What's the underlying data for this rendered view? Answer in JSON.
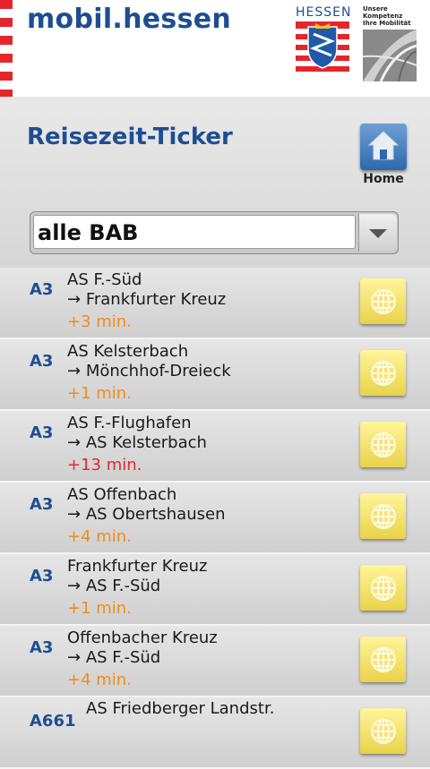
{
  "header": {
    "app_title": "mobil.hessen",
    "hessen_logo_text": "HESSEN",
    "mobility_slogan": "Unsere Kompetenz Ihre Mobilität",
    "stripe_colors": [
      "#e4262b",
      "#ffffff"
    ]
  },
  "page": {
    "title": "Reisezeit-Ticker",
    "home_label": "Home"
  },
  "filter": {
    "selected": "alle BAB"
  },
  "colors": {
    "brand_blue": "#1e4e91",
    "delay_orange": "#f08c1e",
    "delay_red": "#e22828"
  },
  "routes": [
    {
      "road": "A3",
      "from": "AS F.-Süd",
      "to": "Frankfurter Kreuz",
      "delay": "+3 min.",
      "level": "orange"
    },
    {
      "road": "A3",
      "from": "AS Kelsterbach",
      "to": "Mönchhof-Dreieck",
      "delay": "+1 min.",
      "level": "orange"
    },
    {
      "road": "A3",
      "from": "AS F.-Flughafen",
      "to": "AS Kelsterbach",
      "delay": "+13 min.",
      "level": "red"
    },
    {
      "road": "A3",
      "from": "AS Offenbach",
      "to": "AS Obertshausen",
      "delay": "+4 min.",
      "level": "orange"
    },
    {
      "road": "A3",
      "from": "Frankfurter Kreuz",
      "to": "AS F.-Süd",
      "delay": "+1 min.",
      "level": "orange"
    },
    {
      "road": "A3",
      "from": "Offenbacher Kreuz",
      "to": "AS F.-Süd",
      "delay": "+4 min.",
      "level": "orange"
    },
    {
      "road": "A661",
      "from": "AS Friedberger Landstr.",
      "to": "",
      "delay": "",
      "level": "orange"
    }
  ]
}
